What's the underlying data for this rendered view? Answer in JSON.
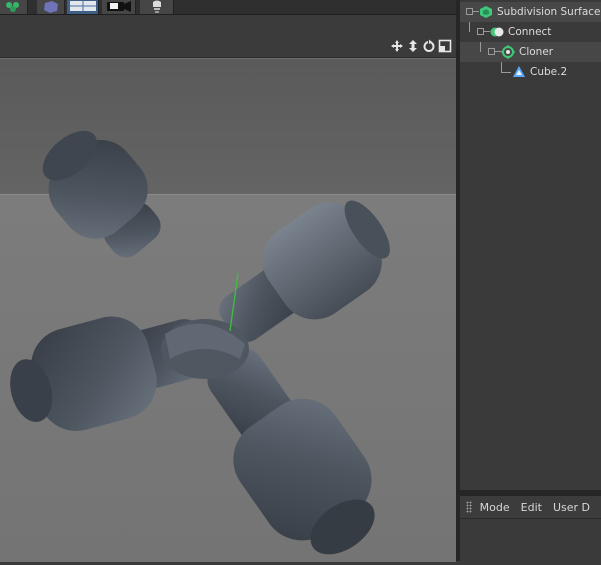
{
  "object_manager": {
    "objects": [
      {
        "name": "Subdivision Surface",
        "icon": "subdivision-surface-icon"
      },
      {
        "name": "Connect",
        "icon": "connect-icon"
      },
      {
        "name": "Cloner",
        "icon": "cloner-icon"
      },
      {
        "name": "Cube.2",
        "icon": "polygon-object-icon"
      }
    ]
  },
  "attribute_manager": {
    "menus": [
      "Mode",
      "Edit",
      "User D"
    ]
  },
  "viewport": {
    "nav_icons": [
      "move-view-icon",
      "dolly-view-icon",
      "rotate-view-icon",
      "toggle-view-icon"
    ],
    "scene": "Subdivided cloned cube cross (4-arm jack) in dark grey metal"
  },
  "colors": {
    "accent_green": "#3ec97a",
    "object_blue": "#5aa9ff",
    "viewport_top": "#5e5e5e",
    "viewport_floor": "#777777"
  }
}
